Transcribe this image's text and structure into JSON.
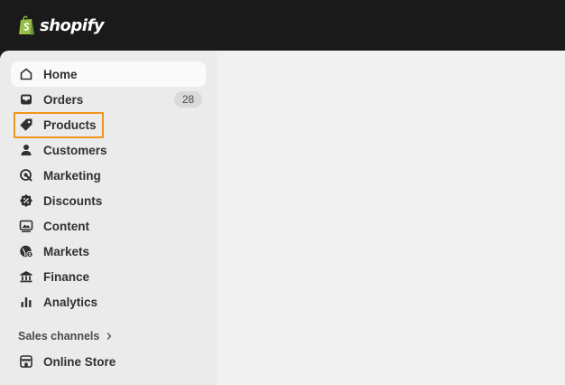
{
  "brand": {
    "name": "shopify",
    "logo_icon": "shopify-bag-icon",
    "logo_color": "#95bf47"
  },
  "nav": {
    "items": [
      {
        "id": "home",
        "label": "Home",
        "icon": "home-icon",
        "active": true
      },
      {
        "id": "orders",
        "label": "Orders",
        "icon": "inbox-icon",
        "badge": "28"
      },
      {
        "id": "products",
        "label": "Products",
        "icon": "tag-icon",
        "highlighted": true
      },
      {
        "id": "customers",
        "label": "Customers",
        "icon": "person-icon"
      },
      {
        "id": "marketing",
        "label": "Marketing",
        "icon": "target-icon"
      },
      {
        "id": "discounts",
        "label": "Discounts",
        "icon": "discount-badge-icon"
      },
      {
        "id": "content",
        "label": "Content",
        "icon": "image-icon"
      },
      {
        "id": "markets",
        "label": "Markets",
        "icon": "globe-icon"
      },
      {
        "id": "finance",
        "label": "Finance",
        "icon": "bank-icon"
      },
      {
        "id": "analytics",
        "label": "Analytics",
        "icon": "bar-chart-icon"
      }
    ]
  },
  "sales_channels": {
    "heading": "Sales channels",
    "items": [
      {
        "id": "online-store",
        "label": "Online Store",
        "icon": "storefront-icon"
      }
    ]
  },
  "colors": {
    "topbar": "#1a1a1a",
    "sidebar": "#ebebeb",
    "main": "#f1f1f1",
    "highlight": "#f0961e"
  }
}
